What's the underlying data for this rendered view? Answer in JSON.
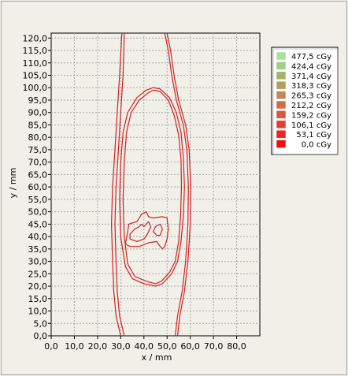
{
  "chart_data": {
    "type": "line",
    "xlabel": "x / mm",
    "ylabel": "y / mm",
    "xlim": [
      0,
      90
    ],
    "ylim": [
      0,
      122
    ],
    "x_ticks": [
      "0,0",
      "10,0",
      "20,0",
      "30,0",
      "40,0",
      "50,0",
      "60,0",
      "70,0",
      "80,0"
    ],
    "y_ticks": [
      "0,0",
      "5,0",
      "10,0",
      "15,0",
      "20,0",
      "25,0",
      "30,0",
      "35,0",
      "40,0",
      "45,0",
      "50,0",
      "55,0",
      "60,0",
      "65,0",
      "70,0",
      "75,0",
      "80,0",
      "85,0",
      "90,0",
      "95,0",
      "100,0",
      "105,0",
      "110,0",
      "115,0",
      "120,0"
    ],
    "grid": true,
    "legend_position": "right",
    "legend": [
      {
        "label": "477,5 cGy",
        "color": "#a8e0a0"
      },
      {
        "label": "424,4 cGy",
        "color": "#9ed08a"
      },
      {
        "label": "371,4 cGy",
        "color": "#a6b268"
      },
      {
        "label": "318,3 cGy",
        "color": "#b0a060"
      },
      {
        "label": "265,3 cGy",
        "color": "#c08858"
      },
      {
        "label": "212,2 cGy",
        "color": "#d07048"
      },
      {
        "label": "159,2 cGy",
        "color": "#d85840"
      },
      {
        "label": "106,1 cGy",
        "color": "#e04030"
      },
      {
        "label": "53,1 cGy",
        "color": "#e82820"
      },
      {
        "label": "0,0 cGy",
        "color": "#f01010"
      }
    ],
    "series": [
      {
        "color": "#d02020",
        "points": [
          [
            30,
            0
          ],
          [
            28,
            8
          ],
          [
            27,
            18
          ],
          [
            26.5,
            30
          ],
          [
            26,
            45
          ],
          [
            26.5,
            60
          ],
          [
            27.5,
            75
          ],
          [
            28.5,
            90
          ],
          [
            29.5,
            105
          ],
          [
            30.5,
            122
          ]
        ]
      },
      {
        "color": "#d02020",
        "points": [
          [
            31.5,
            0
          ],
          [
            29.5,
            8
          ],
          [
            28.5,
            18
          ],
          [
            28,
            30
          ],
          [
            27.5,
            45
          ],
          [
            28,
            60
          ],
          [
            29,
            75
          ],
          [
            30,
            90
          ],
          [
            31,
            105
          ],
          [
            31.5,
            122
          ]
        ]
      },
      {
        "color": "#d02020",
        "points": [
          [
            54.5,
            0
          ],
          [
            55.5,
            8
          ],
          [
            57.5,
            18
          ],
          [
            59,
            30
          ],
          [
            60,
            45
          ],
          [
            60.2,
            60
          ],
          [
            59.5,
            75
          ],
          [
            58,
            85
          ],
          [
            55,
            95
          ],
          [
            53,
            105
          ],
          [
            51.5,
            115
          ],
          [
            50,
            122
          ]
        ]
      },
      {
        "color": "#d02020",
        "points": [
          [
            53.5,
            0
          ],
          [
            54.5,
            8
          ],
          [
            56.5,
            18
          ],
          [
            58,
            30
          ],
          [
            59,
            45
          ],
          [
            59.2,
            60
          ],
          [
            58.5,
            75
          ],
          [
            57,
            85
          ],
          [
            54,
            95
          ],
          [
            52,
            105
          ],
          [
            50.5,
            115
          ],
          [
            49,
            122
          ]
        ]
      },
      {
        "color": "#d02020",
        "closed": true,
        "points": [
          [
            45,
            20
          ],
          [
            40,
            21
          ],
          [
            35,
            23
          ],
          [
            32,
            28
          ],
          [
            30,
            40
          ],
          [
            29.5,
            55
          ],
          [
            30,
            70
          ],
          [
            31,
            82
          ],
          [
            33,
            90
          ],
          [
            37,
            96
          ],
          [
            41,
            99
          ],
          [
            44,
            100
          ],
          [
            47,
            99.5
          ],
          [
            51,
            96
          ],
          [
            54,
            90
          ],
          [
            56,
            82
          ],
          [
            57,
            72
          ],
          [
            57.5,
            60
          ],
          [
            57,
            48
          ],
          [
            56,
            38
          ],
          [
            54.5,
            30
          ],
          [
            52,
            25
          ],
          [
            48,
            21
          ]
        ]
      },
      {
        "color": "#d02020",
        "closed": true,
        "points": [
          [
            45,
            21
          ],
          [
            41,
            22
          ],
          [
            36,
            24
          ],
          [
            33,
            29
          ],
          [
            31.5,
            40
          ],
          [
            31,
            55
          ],
          [
            31.5,
            70
          ],
          [
            32.5,
            82
          ],
          [
            34.5,
            90
          ],
          [
            38,
            95
          ],
          [
            42,
            98
          ],
          [
            44,
            99
          ],
          [
            47,
            98.5
          ],
          [
            50.5,
            95
          ],
          [
            53,
            89
          ],
          [
            55,
            81
          ],
          [
            56,
            71
          ],
          [
            56.2,
            60
          ],
          [
            55.8,
            48
          ],
          [
            55,
            38
          ],
          [
            53.5,
            30
          ],
          [
            51,
            25.5
          ],
          [
            47.5,
            22
          ]
        ]
      },
      {
        "color": "#d02020",
        "closed": true,
        "points": [
          [
            32,
            37
          ],
          [
            33,
            42
          ],
          [
            33.5,
            45
          ],
          [
            35,
            45.5
          ],
          [
            37,
            46
          ],
          [
            39,
            49
          ],
          [
            41,
            50
          ],
          [
            42,
            48
          ],
          [
            44,
            47.5
          ],
          [
            48,
            48
          ],
          [
            50,
            47.5
          ],
          [
            50.5,
            43
          ],
          [
            50,
            39
          ],
          [
            49,
            36
          ],
          [
            48,
            35
          ],
          [
            47,
            36
          ],
          [
            45.5,
            38
          ],
          [
            42,
            37.5
          ],
          [
            38,
            36
          ],
          [
            34,
            36
          ]
        ]
      },
      {
        "color": "#d02020",
        "closed": true,
        "points": [
          [
            34,
            39
          ],
          [
            34,
            41
          ],
          [
            36,
            43
          ],
          [
            38,
            44
          ],
          [
            39,
            45
          ],
          [
            40,
            44
          ],
          [
            42,
            46
          ],
          [
            43,
            44
          ],
          [
            41.5,
            41
          ],
          [
            40,
            39
          ],
          [
            37,
            38
          ]
        ]
      },
      {
        "color": "#d02020",
        "closed": true,
        "points": [
          [
            44,
            42
          ],
          [
            45,
            44
          ],
          [
            47,
            45
          ],
          [
            48,
            43
          ],
          [
            47,
            40.5
          ],
          [
            45.5,
            40.5
          ]
        ]
      }
    ]
  }
}
